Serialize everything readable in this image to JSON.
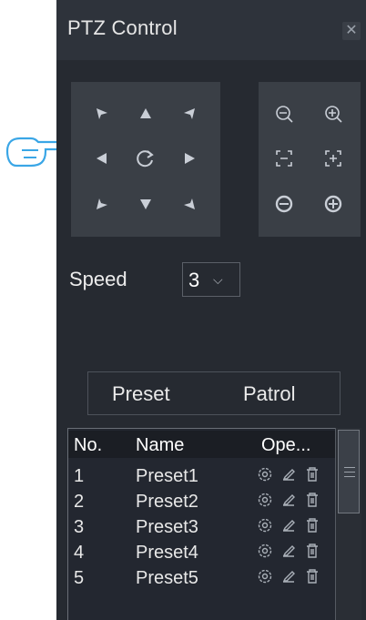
{
  "window": {
    "title": "PTZ Control",
    "close_label": "✕"
  },
  "speed": {
    "label": "Speed",
    "value": "3"
  },
  "tabs": [
    {
      "label": "Preset"
    },
    {
      "label": "Patrol"
    }
  ],
  "table": {
    "headers": {
      "no": "No.",
      "name": "Name",
      "op": "Ope..."
    },
    "rows": [
      {
        "no": "1",
        "name": "Preset1"
      },
      {
        "no": "2",
        "name": "Preset2"
      },
      {
        "no": "3",
        "name": "Preset3"
      },
      {
        "no": "4",
        "name": "Preset4"
      },
      {
        "no": "5",
        "name": "Preset5"
      }
    ]
  },
  "icons": {
    "direction": [
      "up-left-arrow-icon",
      "up-arrow-icon",
      "up-right-arrow-icon",
      "left-arrow-icon",
      "refresh-icon",
      "right-arrow-icon",
      "down-left-arrow-icon",
      "down-arrow-icon",
      "down-right-arrow-icon"
    ],
    "zoom": [
      "zoom-out-icon",
      "zoom-in-icon",
      "focus-near-icon",
      "focus-far-icon",
      "iris-close-icon",
      "iris-open-icon"
    ],
    "row_ops": [
      "settings-icon",
      "edit-icon",
      "delete-icon"
    ]
  },
  "colors": {
    "panel": "#262a31",
    "pad": "#3a3f46",
    "text": "#e8e8e8"
  }
}
